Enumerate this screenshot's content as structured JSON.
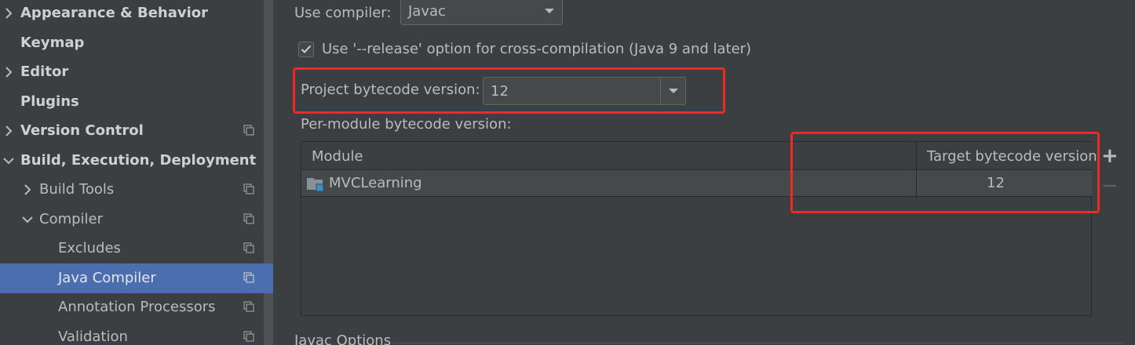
{
  "sidebar": {
    "items": [
      {
        "label": "Appearance & Behavior",
        "arrow": "right",
        "bold": true
      },
      {
        "label": "Keymap",
        "arrow": "",
        "bold": true
      },
      {
        "label": "Editor",
        "arrow": "right",
        "bold": true
      },
      {
        "label": "Plugins",
        "arrow": "",
        "bold": true
      },
      {
        "label": "Version Control",
        "arrow": "right",
        "bold": true
      },
      {
        "label": "Build, Execution, Deployment",
        "arrow": "down",
        "bold": true
      },
      {
        "label": "Build Tools",
        "arrow": "right",
        "bold": false
      },
      {
        "label": "Compiler",
        "arrow": "down",
        "bold": false
      },
      {
        "label": "Excludes",
        "arrow": "",
        "bold": false
      },
      {
        "label": "Java Compiler",
        "arrow": "",
        "bold": false,
        "selected": true
      },
      {
        "label": "Annotation Processors",
        "arrow": "",
        "bold": false
      },
      {
        "label": "Validation",
        "arrow": "",
        "bold": false
      }
    ]
  },
  "main": {
    "use_compiler_label": "Use compiler:",
    "use_compiler_value": "Javac",
    "release_option_label": "Use '--release' option for cross-compilation (Java 9 and later)",
    "release_option_checked": true,
    "project_bytecode_label": "Project bytecode version:",
    "project_bytecode_value": "12",
    "per_module_label": "Per-module bytecode version:",
    "table": {
      "columns": [
        "Module",
        "Target bytecode version"
      ],
      "rows": [
        {
          "module": "MVCLearning",
          "target": "12"
        }
      ]
    },
    "add_button": "+",
    "remove_button": "−",
    "javac_options_label": "Javac Options"
  },
  "colors": {
    "background": "#3c3f41",
    "selection": "#4b6eaf",
    "highlight": "#ee2a24"
  }
}
